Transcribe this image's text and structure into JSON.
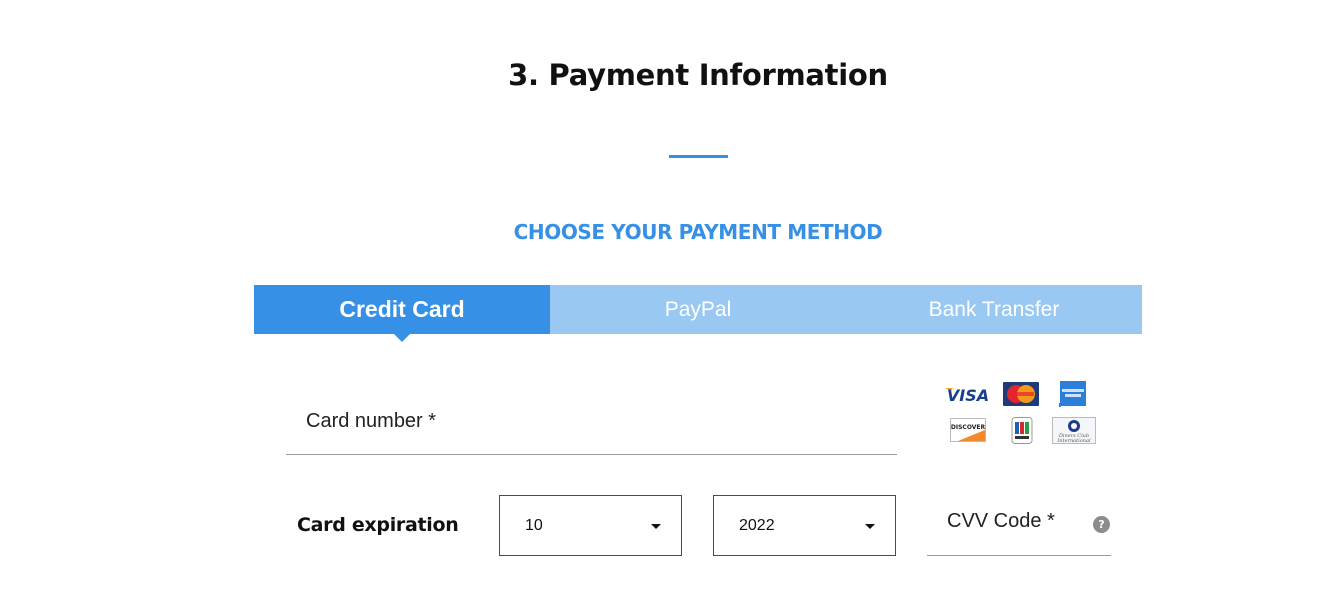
{
  "header": {
    "title": "3. Payment Information",
    "accent_color": "#3590e6"
  },
  "payment_method": {
    "heading": "CHOOSE YOUR PAYMENT METHOD",
    "tabs": [
      {
        "label": "Credit Card",
        "active": true
      },
      {
        "label": "PayPal",
        "active": false
      },
      {
        "label": "Bank Transfer",
        "active": false
      }
    ],
    "active_color": "#3590e6",
    "inactive_color": "#99c8f3"
  },
  "form": {
    "card_number": {
      "label": "Card number *",
      "value": ""
    },
    "card_logos": [
      {
        "name": "visa",
        "label": "VISA"
      },
      {
        "name": "mastercard",
        "label": "MasterCard"
      },
      {
        "name": "american-express",
        "label": "American Express"
      },
      {
        "name": "discover",
        "label": "DISCOVER"
      },
      {
        "name": "jcb",
        "label": "JCB"
      },
      {
        "name": "diners-club",
        "label": "Diners Club International"
      }
    ],
    "expiration": {
      "label": "Card expiration",
      "month": "10",
      "year": "2022"
    },
    "cvv": {
      "label": "CVV Code *",
      "help_icon": "?"
    }
  }
}
